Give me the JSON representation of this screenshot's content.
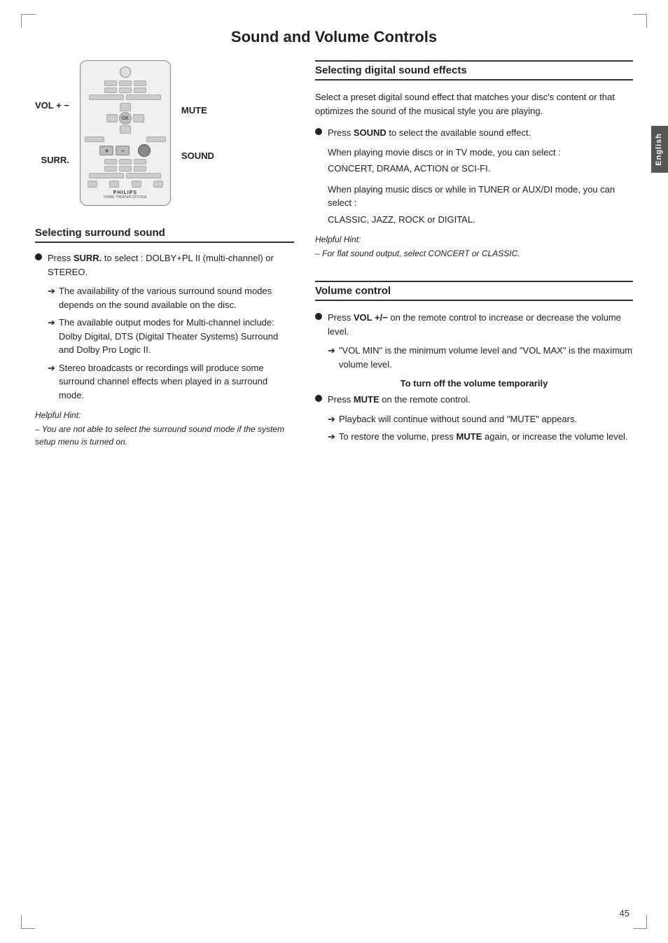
{
  "page": {
    "title": "Sound and Volume Controls",
    "page_number": "45",
    "language_tab": "English"
  },
  "remote": {
    "vol_label": "VOL + −",
    "surr_label": "SURR.",
    "mute_label": "MUTE",
    "sound_label": "SOUND",
    "philips": "PHILIPS",
    "philips_sub": "HOME THEATER SYSTEM"
  },
  "section_surround": {
    "heading": "Selecting surround sound",
    "bullet1": {
      "text_before": "Press ",
      "bold": "SURR.",
      "text_after": " to select : DOLBY+PL II (multi-channel) or STEREO."
    },
    "arrow1": "The availability of the various surround sound modes depends on the sound available on the disc.",
    "arrow2": "The available output modes for Multi-channel include: Dolby Digital, DTS (Digital Theater Systems) Surround and Dolby Pro Logic II.",
    "arrow3": "Stereo broadcasts or recordings will produce some surround channel effects when played in a surround mode.",
    "hint_title": "Helpful Hint:",
    "hint_text": "– You are not able to select the surround sound mode if the system setup menu is turned on."
  },
  "section_digital": {
    "heading": "Selecting digital sound effects",
    "intro": "Select a preset digital sound effect that matches your disc's content or that optimizes the sound of the musical style you are playing.",
    "bullet1": {
      "text_before": "Press ",
      "bold": "SOUND",
      "text_after": " to select the available sound effect."
    },
    "mode1_intro": "When playing movie discs or in TV mode, you can select :",
    "mode1_list": "CONCERT, DRAMA, ACTION or SCI-FI.",
    "mode2_intro": "When playing music discs or while in TUNER or AUX/DI mode, you can select :",
    "mode2_list": "CLASSIC, JAZZ, ROCK or DIGITAL.",
    "hint_title": "Helpful Hint:",
    "hint_text": "– For flat sound output, select CONCERT or CLASSIC."
  },
  "section_volume": {
    "heading": "Volume control",
    "bullet1": {
      "text_before": "Press ",
      "bold": "VOL +/−",
      "text_after": " on the remote control to increase or decrease the volume level."
    },
    "arrow1": "\"VOL MIN\" is the minimum volume level and \"VOL MAX\" is the maximum volume level.",
    "sub_heading": "To turn off the volume temporarily",
    "bullet2": {
      "text_before": "Press ",
      "bold": "MUTE",
      "text_after": " on the remote control."
    },
    "arrow2": "Playback will continue without sound and \"MUTE\" appears.",
    "arrow3_before": "To restore the volume, press ",
    "arrow3_bold": "MUTE",
    "arrow3_after": " again, or increase the volume level."
  }
}
